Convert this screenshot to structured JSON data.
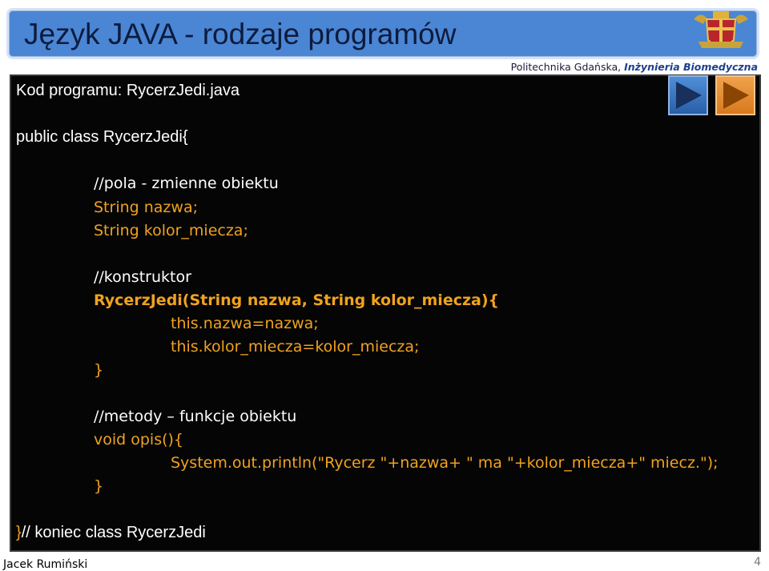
{
  "slide": {
    "title": "Język JAVA - rodzaje programów",
    "subtitle_plain": "Politechnika Gdańska, ",
    "subtitle_emph": "Inżynieria Biomedyczna",
    "page_number": "4",
    "author": "Jacek Rumiński"
  },
  "nav": {
    "back_icon": "play-left-icon",
    "forward_icon": "play-right-icon"
  },
  "code": {
    "heading": "Kod programu: RycerzJedi.java",
    "class_decl": "public class RycerzJedi{",
    "comment_fields": "//pola  - zmienne obiektu",
    "field1": "String nazwa;",
    "field2": "String kolor_miecza;",
    "comment_ctor": "//konstruktor",
    "ctor_sig": "RycerzJedi(String nazwa, String kolor_miecza){",
    "ctor_line1": "this.nazwa=nazwa;",
    "ctor_line2": "this.kolor_miecza=kolor_miecza;",
    "ctor_close": "}",
    "comment_methods": "//metody – funkcje obiektu",
    "method_sig": "void opis(){",
    "method_body": "System.out.println(\"Rycerz \"+nazwa+ \" ma \"+kolor_miecza+\" miecz.\");",
    "method_close": "}",
    "class_close_brace": "}",
    "class_close_comment": "// koniec class RycerzJedi"
  },
  "colors": {
    "title_bar": "#4a86d4",
    "code_bg": "#050505",
    "code_orange": "#f0a21f"
  }
}
